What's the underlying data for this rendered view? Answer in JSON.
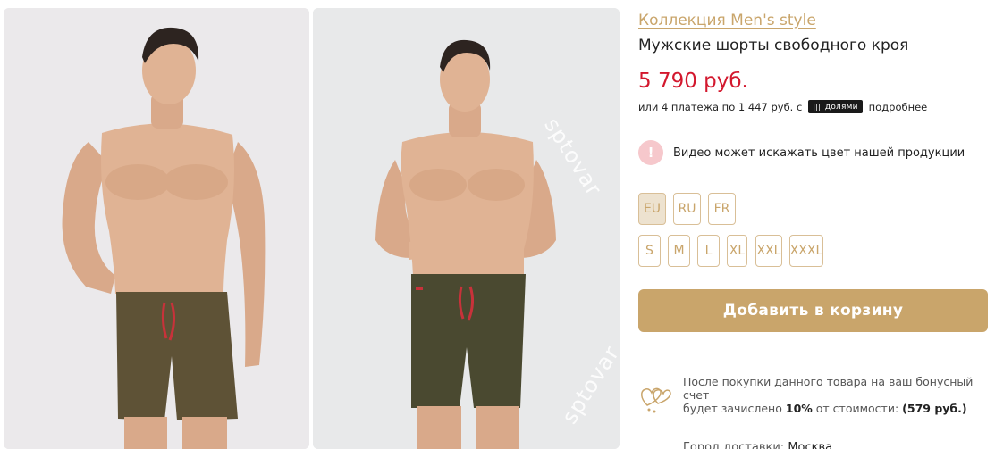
{
  "gallery": {
    "watermark": "sptovar"
  },
  "product": {
    "collection_link": "Коллекция Men's style",
    "title": "Мужские шорты свободного кроя",
    "price": "5 790 руб.",
    "installments": {
      "text": "или 4 платежа по 1 447 руб. с",
      "badge": "долями",
      "more_link": "подробнее"
    },
    "notice": {
      "icon_label": "!",
      "text": "Видео может искажать цвет нашей продукции"
    },
    "size_systems": [
      {
        "label": "EU",
        "selected": true
      },
      {
        "label": "RU",
        "selected": false
      },
      {
        "label": "FR",
        "selected": false
      }
    ],
    "sizes": [
      "S",
      "M",
      "L",
      "XL",
      "XXL",
      "XXXL"
    ],
    "add_to_cart": "Добавить в корзину",
    "bonus": {
      "line1": "После покупки данного товара на ваш бонусный счет",
      "line2_prefix": "будет зачислено",
      "percent": "10%",
      "line2_middle": "от стоимости:",
      "amount": "(579 руб.)"
    },
    "delivery": {
      "label": "Город доставки:",
      "city": "Москва"
    }
  },
  "colors": {
    "accent_gold": "#c9a56b",
    "price_red": "#d3182e",
    "notice_pink": "#f6c8cc"
  }
}
